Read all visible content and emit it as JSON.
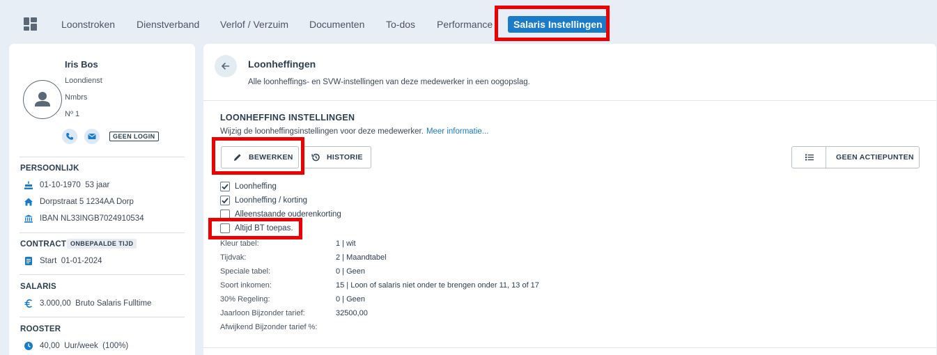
{
  "nav": {
    "tabs": [
      "Loonstroken",
      "Dienstverband",
      "Verlof / Verzuim",
      "Documenten",
      "To-dos",
      "Performance"
    ],
    "active_tab": "Salaris Instellingen"
  },
  "employee": {
    "name": "Iris Bos",
    "department": "Loondienst",
    "company": "Nmbrs",
    "number": "Nº 1",
    "login_badge": "GEEN LOGIN"
  },
  "personal": {
    "title": "PERSOONLIJK",
    "birthdate": "01-10-1970",
    "age": "53 jaar",
    "address": "Dorpstraat 5 1234AA Dorp",
    "iban": "IBAN NL33INGB7024910534"
  },
  "contract": {
    "title": "CONTRACT",
    "badge": "ONBEPAALDE TIJD",
    "start_label": "Start",
    "start_date": "01-01-2024"
  },
  "salary": {
    "title": "SALARIS",
    "amount": "3.000,00",
    "description": "Bruto Salaris Fulltime"
  },
  "schedule": {
    "title": "ROOSTER",
    "hours": "40,00",
    "unit": "Uur/week",
    "percentage": "(100%)"
  },
  "page": {
    "title": "Loonheffingen",
    "subtitle": "Alle loonheffings- en SVW-instellingen van deze medewerker in een oogopslag."
  },
  "section": {
    "title": "LOONHEFFING INSTELLINGEN",
    "description": "Wijzig de loonheffingsinstellingen voor deze medewerker.",
    "link": "Meer informatie..."
  },
  "buttons": {
    "edit": "BEWERKEN",
    "history": "HISTORIE",
    "actions": "GEEN ACTIEPUNTEN"
  },
  "checkboxes": [
    {
      "label": "Loonheffing",
      "checked": true
    },
    {
      "label": "Loonheffing / korting",
      "checked": true
    },
    {
      "label": "Alleenstaande ouderenkorting",
      "checked": false
    },
    {
      "label": "Altijd BT toepas.",
      "checked": false
    }
  ],
  "settings": [
    {
      "label": "Kleur tabel:",
      "value": "1 | wit"
    },
    {
      "label": "Tijdvak:",
      "value": "2 | Maandtabel"
    },
    {
      "label": "Speciale tabel:",
      "value": "0 | Geen"
    },
    {
      "label": "Soort inkomen:",
      "value": "15 | Loon of salaris niet onder te brengen onder 11, 13 of 17"
    },
    {
      "label": "30% Regeling:",
      "value": "0 | Geen"
    },
    {
      "label": "Jaarloon Bijzonder tarief:",
      "value": "32500,00"
    },
    {
      "label": "Afwijkend Bijzonder tarief %:",
      "value": ""
    }
  ],
  "colors": {
    "accent": "#1a7bc9",
    "highlight": "#ef0000",
    "background": "#e8eef6"
  }
}
